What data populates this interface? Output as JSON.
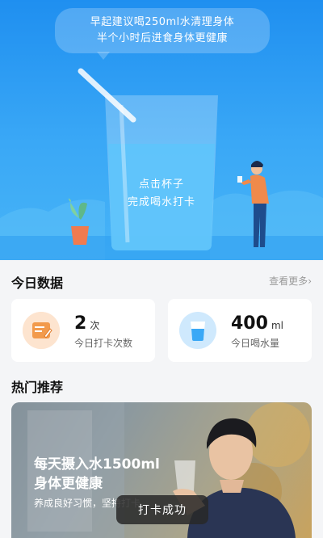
{
  "hero": {
    "bubble_line1": "早起建议喝250ml水清理身体",
    "bubble_line2": "半个小时后进食身体更健康",
    "cup_line1": "点击杯子",
    "cup_line2": "完成喝水打卡"
  },
  "today": {
    "title": "今日数据",
    "more_label": "查看更多",
    "checkin": {
      "value": "2",
      "unit": "次",
      "label": "今日打卡次数"
    },
    "water": {
      "value": "400",
      "unit": "ml",
      "label": "今日喝水量"
    }
  },
  "recommend": {
    "title": "热门推荐",
    "banner_line1": "每天摄入水1500ml",
    "banner_line2": "身体更健康",
    "banner_line3": "养成良好习惯，坚持打卡"
  },
  "toast": "打卡成功",
  "colors": {
    "hero_blue": "#1f8ff0",
    "checkin_orange": "#f29a4c",
    "water_blue": "#3aa8f6"
  }
}
